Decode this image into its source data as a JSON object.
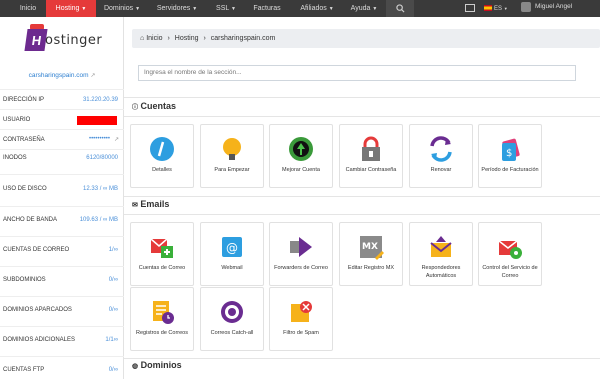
{
  "nav": {
    "items": [
      "Inicio",
      "Hosting",
      "Dominios",
      "Servidores",
      "SSL",
      "Facturas",
      "Afiliados",
      "Ayuda"
    ],
    "lang": "ES",
    "user": "Miguel Angel",
    "active_color": "#e53a3a"
  },
  "sidebar": {
    "domain": "carsharingspain.com",
    "rows": [
      {
        "label": "DIRECCIÓN IP",
        "value": "31.220.20.39"
      },
      {
        "label": "USUARIO",
        "value": ""
      },
      {
        "label": "CONTRASEÑA",
        "value": "••••••••••"
      },
      {
        "label": "INODOS",
        "value": "6120/80000"
      },
      {
        "label": "USO DE DISCO",
        "value": "12.33 / ∞ MB"
      },
      {
        "label": "ANCHO DE BANDA",
        "value": "109.63 / ∞ MB"
      },
      {
        "label": "CUENTAS DE CORREO",
        "value": "1/∞"
      },
      {
        "label": "SUBDOMINIOS",
        "value": "0/∞"
      },
      {
        "label": "DOMINIOS APARCADOS",
        "value": "0/∞"
      },
      {
        "label": "DOMINIOS ADICIONALES",
        "value": "1/1∞"
      },
      {
        "label": "CUENTAS FTP",
        "value": "0/∞"
      }
    ]
  },
  "breadcrumb": {
    "home": "Inicio",
    "hosting": "Hosting",
    "domain": "carsharingspain.com"
  },
  "search": {
    "placeholder": "Ingresa el nombre de la sección..."
  },
  "sections": {
    "cuentas": {
      "title": "Cuentas",
      "tiles": [
        {
          "label": "Detalles",
          "icon": "info-icon"
        },
        {
          "label": "Para Empezar",
          "icon": "lightbulb-icon"
        },
        {
          "label": "Mejorar Cuenta",
          "icon": "upgrade-icon"
        },
        {
          "label": "Cambiar Contraseña",
          "icon": "lock-icon"
        },
        {
          "label": "Renovar",
          "icon": "renew-icon"
        },
        {
          "label": "Período de Facturación",
          "icon": "billing-icon"
        }
      ]
    },
    "emails": {
      "title": "Emails",
      "tiles": [
        {
          "label": "Cuentas de Correo",
          "icon": "mail-accounts-icon"
        },
        {
          "label": "Webmail",
          "icon": "webmail-icon"
        },
        {
          "label": "Forwarders de Correo",
          "icon": "forwarders-icon"
        },
        {
          "label": "Editar Registro MX",
          "icon": "mx-icon"
        },
        {
          "label": "Respondedores Automáticos",
          "icon": "autoresponder-icon"
        },
        {
          "label": "Control del Servicio de Correo",
          "icon": "mail-control-icon"
        },
        {
          "label": "Registros de Correos",
          "icon": "mail-logs-icon"
        },
        {
          "label": "Correos Catch-all",
          "icon": "catch-all-icon"
        },
        {
          "label": "Filtro de Spam",
          "icon": "spam-filter-icon"
        }
      ]
    },
    "dominios": {
      "title": "Dominios"
    }
  }
}
